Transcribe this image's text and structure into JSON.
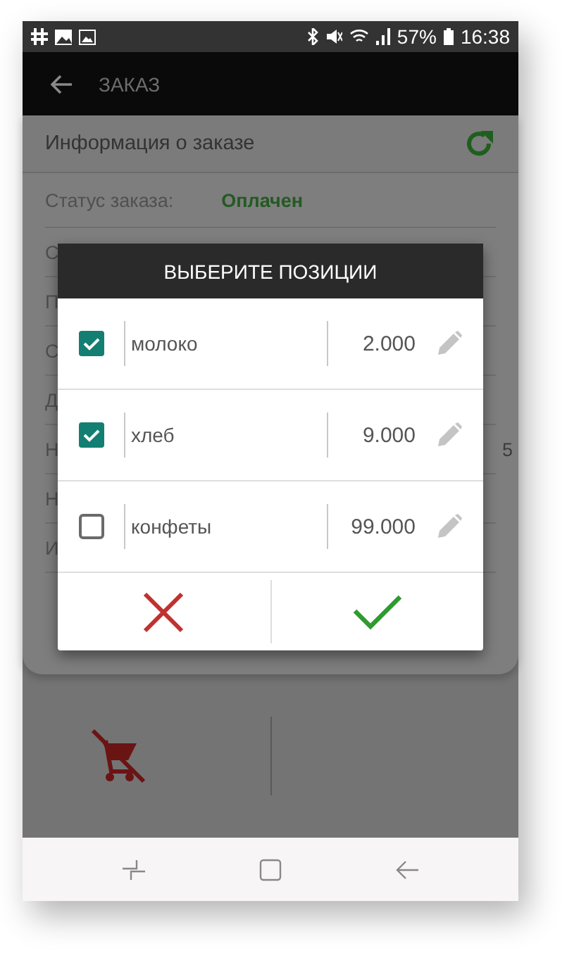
{
  "status_bar": {
    "battery": "57%",
    "time": "16:38"
  },
  "app_bar": {
    "title": "ЗАКАЗ"
  },
  "order_info": {
    "title": "Информация о заказе",
    "rows": [
      {
        "label": "Статус заказа:",
        "value": "Оплачен"
      },
      {
        "label": "С"
      },
      {
        "label": "П"
      },
      {
        "label": "С"
      },
      {
        "label": "Д"
      },
      {
        "label": "Н",
        "value": "5"
      },
      {
        "label": "Н"
      },
      {
        "label": "И"
      }
    ]
  },
  "dialog": {
    "title": "ВЫБЕРИТЕ ПОЗИЦИИ",
    "items": [
      {
        "name": "молоко",
        "quantity": "2.000",
        "checked": true
      },
      {
        "name": "хлеб",
        "quantity": "9.000",
        "checked": true
      },
      {
        "name": "конфеты",
        "quantity": "99.000",
        "checked": false
      }
    ]
  }
}
